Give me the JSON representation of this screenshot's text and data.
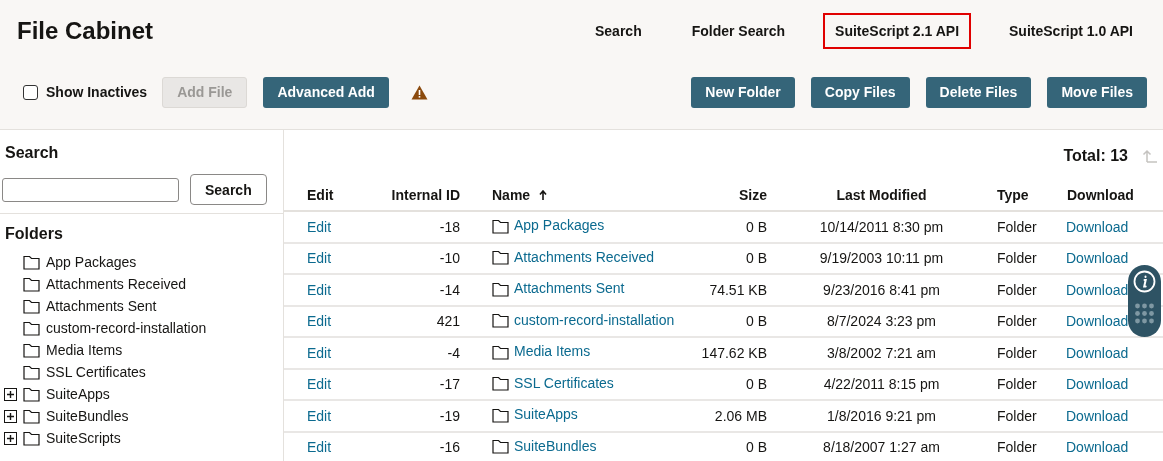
{
  "page": {
    "title": "File Cabinet"
  },
  "nav_links": [
    {
      "label": "Search",
      "highlighted": false
    },
    {
      "label": "Folder Search",
      "highlighted": false
    },
    {
      "label": "SuiteScript 2.1 API",
      "highlighted": true
    },
    {
      "label": "SuiteScript 1.0 API",
      "highlighted": false
    }
  ],
  "toolbar": {
    "show_inactives": {
      "label": "Show Inactives",
      "checked": false
    },
    "left_buttons": [
      {
        "label": "Add File",
        "disabled": true
      },
      {
        "label": "Advanced Add",
        "disabled": false
      }
    ],
    "right_buttons": [
      {
        "label": "New Folder",
        "disabled": false
      },
      {
        "label": "Copy Files",
        "disabled": false
      },
      {
        "label": "Delete Files",
        "disabled": false
      },
      {
        "label": "Move Files",
        "disabled": false
      }
    ]
  },
  "sidebar": {
    "search_heading": "Search",
    "search_button": "Search",
    "folders_heading": "Folders",
    "folders": [
      {
        "label": "App Packages",
        "expandable": false
      },
      {
        "label": "Attachments Received",
        "expandable": false
      },
      {
        "label": "Attachments Sent",
        "expandable": false
      },
      {
        "label": "custom-record-installation",
        "expandable": false
      },
      {
        "label": "Media Items",
        "expandable": false
      },
      {
        "label": "SSL Certificates",
        "expandable": false
      },
      {
        "label": "SuiteApps",
        "expandable": true
      },
      {
        "label": "SuiteBundles",
        "expandable": true
      },
      {
        "label": "SuiteScripts",
        "expandable": true
      }
    ]
  },
  "table": {
    "total": "Total: 13",
    "columns": [
      {
        "label": "Edit",
        "sorted": false
      },
      {
        "label": "Internal ID",
        "sorted": false
      },
      {
        "label": "Name",
        "sorted": true
      },
      {
        "label": "Size",
        "sorted": false
      },
      {
        "label": "Last Modified",
        "sorted": false
      },
      {
        "label": "Type",
        "sorted": false
      },
      {
        "label": "Download",
        "sorted": false
      }
    ],
    "rows": [
      {
        "edit": "Edit",
        "internal_id": "-18",
        "name": "App Packages",
        "size": "0 B",
        "last_modified": "10/14/2011 8:30 pm",
        "type": "Folder",
        "download": "Download"
      },
      {
        "edit": "Edit",
        "internal_id": "-10",
        "name": "Attachments Received",
        "size": "0 B",
        "last_modified": "9/19/2003 10:11 pm",
        "type": "Folder",
        "download": "Download"
      },
      {
        "edit": "Edit",
        "internal_id": "-14",
        "name": "Attachments Sent",
        "size": "74.51 KB",
        "last_modified": "9/23/2016 8:41 pm",
        "type": "Folder",
        "download": "Download"
      },
      {
        "edit": "Edit",
        "internal_id": "421",
        "name": "custom-record-installation",
        "size": "0 B",
        "last_modified": "8/7/2024 3:23 pm",
        "type": "Folder",
        "download": "Download"
      },
      {
        "edit": "Edit",
        "internal_id": "-4",
        "name": "Media Items",
        "size": "147.62 KB",
        "last_modified": "3/8/2002 7:21 am",
        "type": "Folder",
        "download": "Download"
      },
      {
        "edit": "Edit",
        "internal_id": "-17",
        "name": "SSL Certificates",
        "size": "0 B",
        "last_modified": "4/22/2011 8:15 pm",
        "type": "Folder",
        "download": "Download"
      },
      {
        "edit": "Edit",
        "internal_id": "-19",
        "name": "SuiteApps",
        "size": "2.06 MB",
        "last_modified": "1/8/2016 9:21 pm",
        "type": "Folder",
        "download": "Download"
      },
      {
        "edit": "Edit",
        "internal_id": "-16",
        "name": "SuiteBundles",
        "size": "0 B",
        "last_modified": "8/18/2007 1:27 am",
        "type": "Folder",
        "download": "Download"
      }
    ]
  }
}
